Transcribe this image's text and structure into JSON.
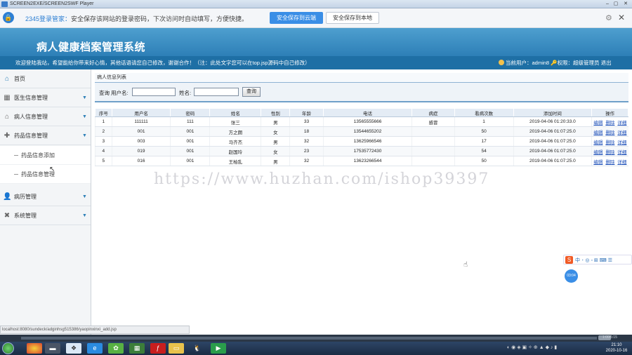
{
  "player": {
    "title": "SCREEN2EXE/SCREEN2SWF Player",
    "min": "–",
    "max": "▢",
    "close": "✕"
  },
  "password_bar": {
    "brand": "2345登录管家：",
    "message": "安全保存该网站的登录密码，下次访问时自动填写，方便快捷。",
    "save_cloud": "安全保存到云端",
    "save_local": "安全保存到本地"
  },
  "header": {
    "title": "病人健康档案管理系统"
  },
  "subbar": {
    "welcome": "欢迎登陆我站，希望能给你带来好心情，其他话语请您自己修改，谢谢合作！（注：此处文字您可以在top.jsp源码中自己修改）",
    "user_label": "当前用户：",
    "user": "admin8",
    "role_label": "权限：",
    "role": "超级管理员",
    "logout": "退出"
  },
  "sidebar": {
    "home": "首页",
    "items": [
      {
        "label": "医生信息管理"
      },
      {
        "label": "病人信息管理"
      },
      {
        "label": "药品信息管理"
      }
    ],
    "sub_items": [
      {
        "label": "药品信息添加"
      },
      {
        "label": "药品信息管理"
      }
    ],
    "items2": [
      {
        "label": "病历管理"
      },
      {
        "label": "系统管理"
      }
    ]
  },
  "panel": {
    "title": "病人信息列表",
    "query_label": "查询",
    "username_label": "用户名:",
    "name_label": "姓名:",
    "search_button": "查询",
    "username_value": "",
    "name_value": ""
  },
  "table": {
    "headers": [
      "序号",
      "用户名",
      "密码",
      "姓名",
      "性别",
      "年龄",
      "电话",
      "病症",
      "看病次数",
      "添加时间",
      "操作"
    ],
    "ops": [
      "编辑",
      "删除",
      "详细"
    ],
    "rows": [
      [
        "1",
        "111111",
        "111",
        "张三",
        "男",
        "33",
        "13565555666",
        "感冒",
        "1",
        "2019-04-06 01:20:33.0"
      ],
      [
        "2",
        "001",
        "001",
        "方之朗",
        "女",
        "18",
        "13544655202",
        "",
        "50",
        "2019-04-06 01:07:25.0"
      ],
      [
        "3",
        "003",
        "001",
        "马齐杰",
        "男",
        "32",
        "13625966546",
        "",
        "17",
        "2019-04-06 01:07:25.0"
      ],
      [
        "4",
        "019",
        "001",
        "赵国玲",
        "女",
        "23",
        "17535772430",
        "",
        "54",
        "2019-04-06 01:07:25.0"
      ],
      [
        "5",
        "016",
        "001",
        "王柏乱",
        "男",
        "32",
        "13623266544",
        "",
        "50",
        "2019-04-06 01:07:25.0"
      ]
    ]
  },
  "watermark": "https://www.huzhan.com/ishop39397",
  "status_url": "localhost:8080/sundeck/adginhsg515386/yaopinxinxi_add.jsp",
  "ime": {
    "logo": "S",
    "tools": "中 ･ ◎ ◦ ⊞ ⌨ ☰"
  },
  "ball": "03:04",
  "clock": {
    "time": "21:10",
    "date": "2020-10-16"
  },
  "scroll_time": "1:00/5:15",
  "colors": {
    "header": "#2d7fb7",
    "subbar": "#1e6fa5",
    "accent": "#3a8ee6"
  }
}
